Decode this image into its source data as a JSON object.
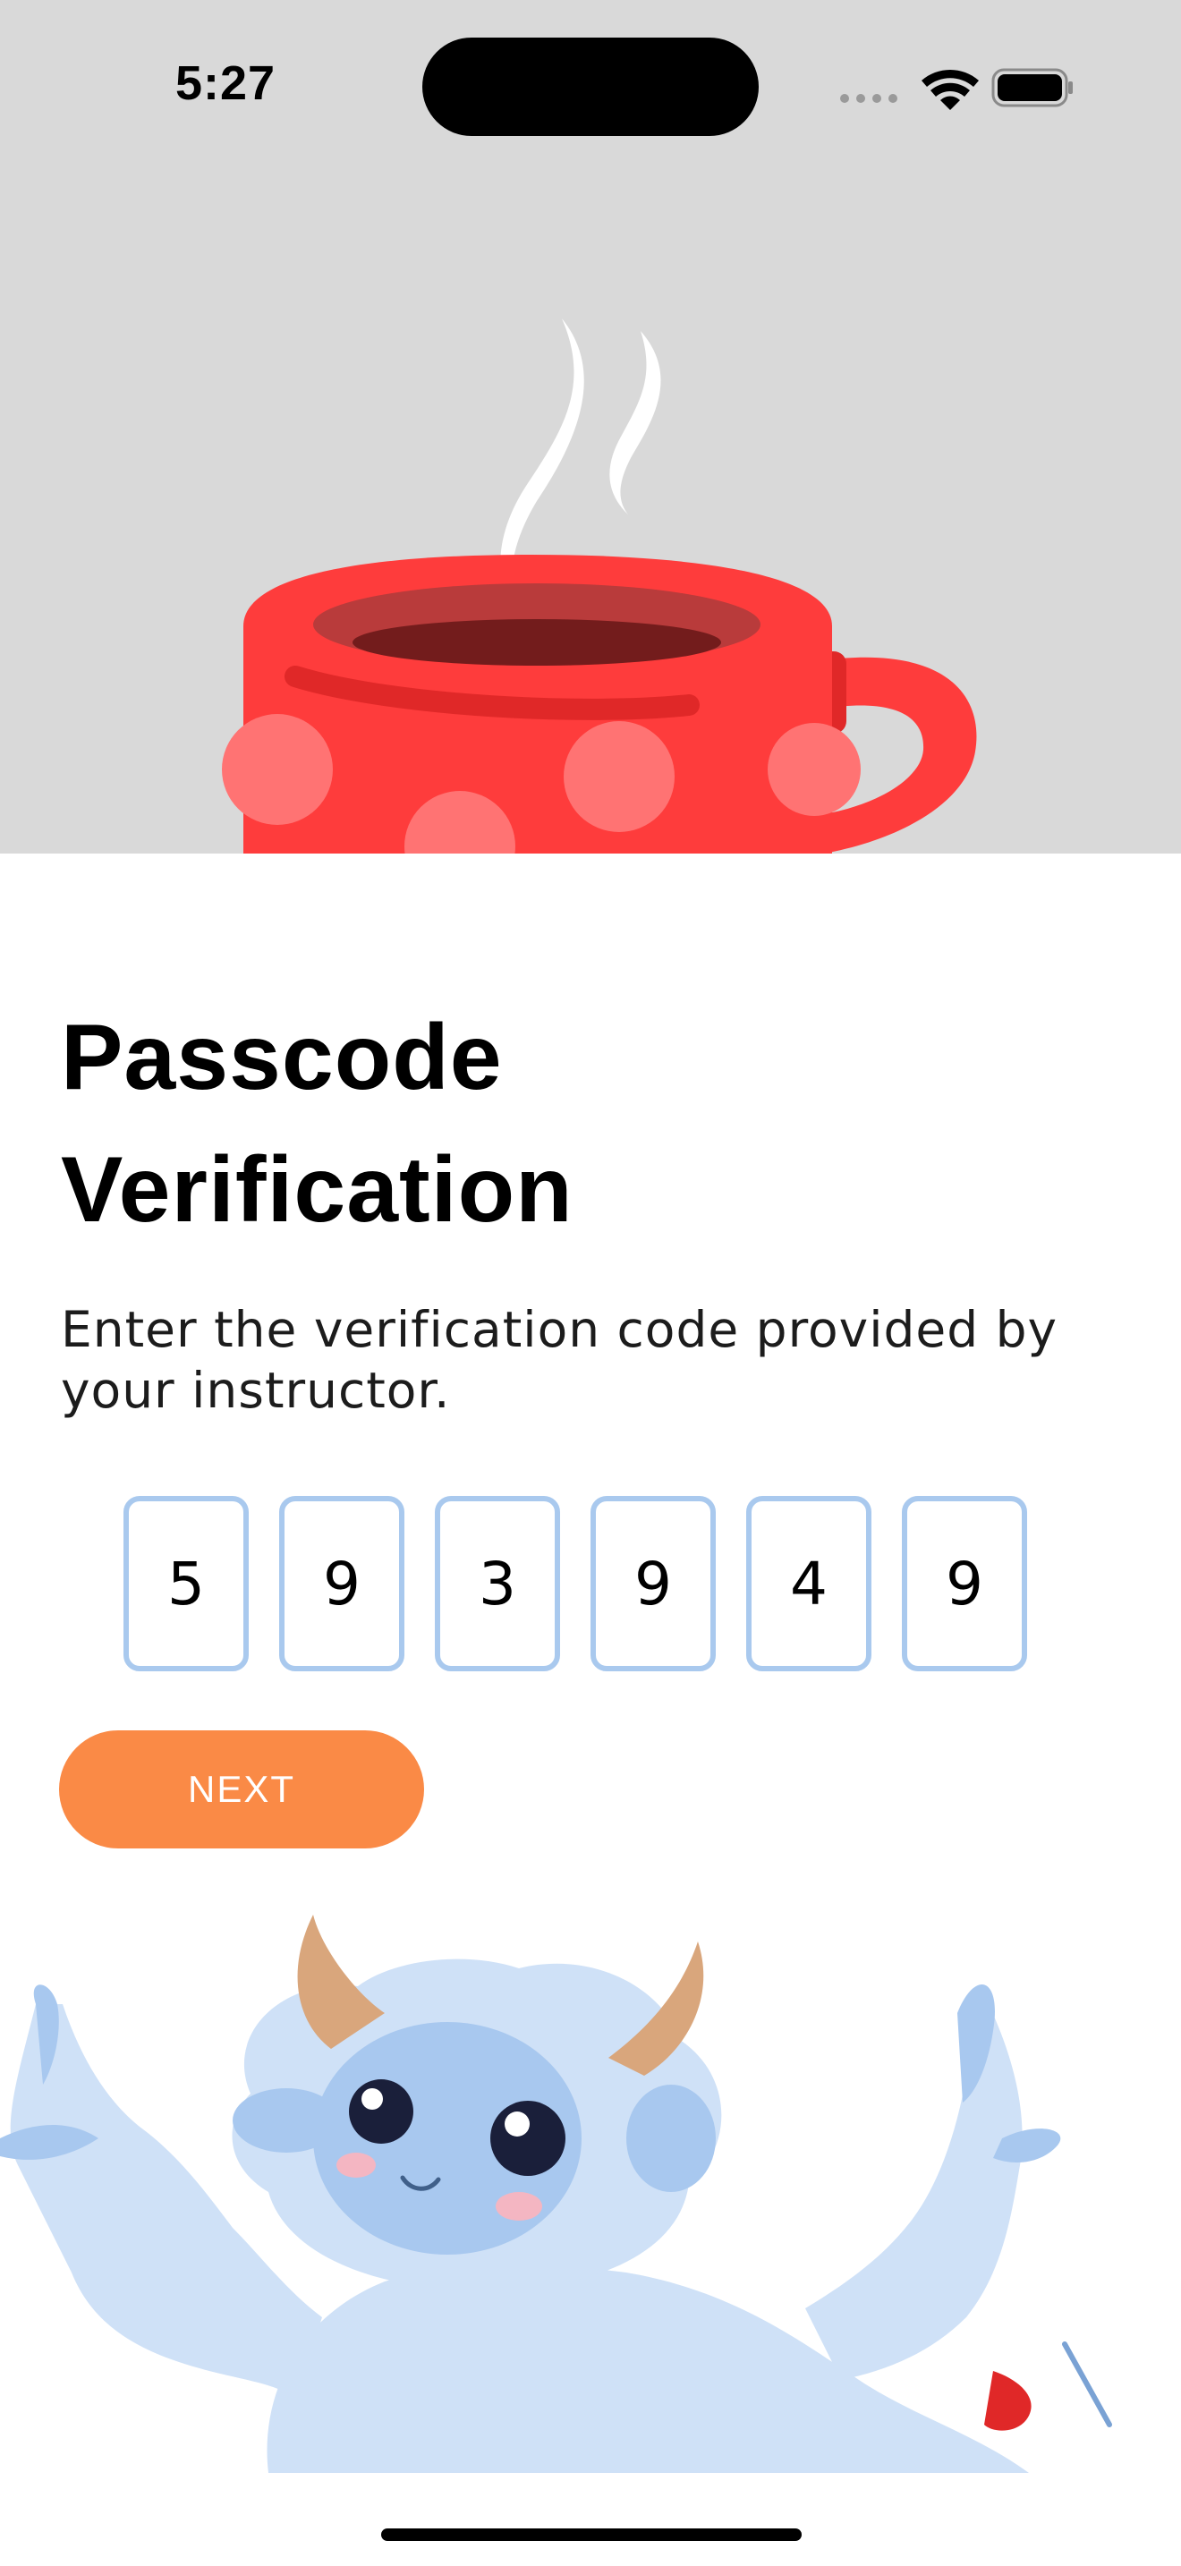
{
  "status_bar": {
    "time": "5:27",
    "icons": [
      "cellular-dots-icon",
      "wifi-icon",
      "battery-icon"
    ]
  },
  "hero": {
    "background_color": "#d9d9d9",
    "illustration": "polka-dot-coffee-mug-with-steam"
  },
  "page": {
    "title_line1": "Passcode",
    "title_line2": "Verification",
    "subtitle": "Enter the verification code provided by your instructor."
  },
  "code_input": {
    "digits": [
      "5",
      "9",
      "3",
      "9",
      "4",
      "9"
    ],
    "border_color": "#a9c9ee"
  },
  "next_button": {
    "label": "NEXT",
    "color": "#fa8a46"
  },
  "footer_illustration": "fluffy-horned-yeti-mascot",
  "colors": {
    "mug_red": "#fe3c3c",
    "yeti_blue": "#cfe1f7"
  }
}
